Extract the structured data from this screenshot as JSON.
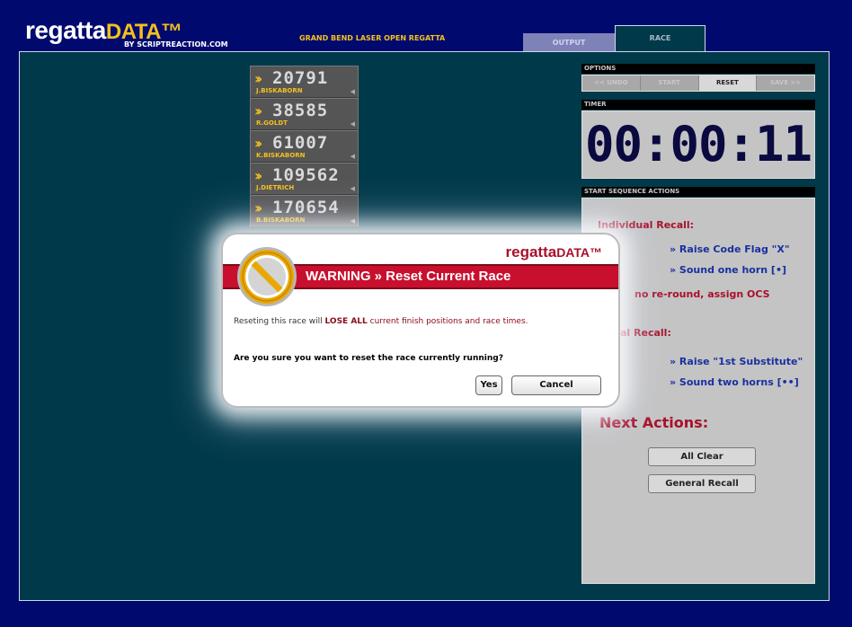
{
  "header": {
    "logo_main": "regatta",
    "logo_accent": "DATA™",
    "logo_sub": "BY SCRIPTREACTION.COM",
    "event_title": "GRAND BEND LASER OPEN REGATTA"
  },
  "tabs": [
    {
      "label": "OUTPUT",
      "active": false
    },
    {
      "label": "RACE",
      "active": true
    }
  ],
  "finishers": [
    {
      "sail": "20791",
      "name": "J.BISKABORN"
    },
    {
      "sail": "38585",
      "name": "R.GOLDT"
    },
    {
      "sail": "61007",
      "name": "K.BISKABORN"
    },
    {
      "sail": "109562",
      "name": "J.DIETRICH"
    },
    {
      "sail": "170654",
      "name": "B.BISKABORN"
    }
  ],
  "options": {
    "title": "OPTIONS",
    "buttons": [
      "<< UNDO",
      "START",
      "RESET",
      "SAVE >>"
    ],
    "active": "RESET"
  },
  "timer": {
    "title": "TIMER",
    "value": "00:00:11"
  },
  "sequence": {
    "title": "START SEQUENCE ACTIONS",
    "individual_recall": "Individual Recall:",
    "raise_x": "» Raise Code Flag \"X\"",
    "sound_one": "» Sound one horn [•]",
    "no_reround": "no re-round, assign OCS",
    "general_recall_partial": "al Recall:",
    "raise_sub": "» Raise \"1st Substitute\"",
    "sound_two": "» Sound two horns [••]",
    "next_actions": "Next Actions:",
    "all_clear": "All Clear",
    "general_recall": "General Recall"
  },
  "dialog": {
    "logo_main": "regatta",
    "logo_accent": "DATA™",
    "title": "WARNING » Reset Current Race",
    "msg_pre": "Reseting this race will ",
    "msg_highlight": "LOSE ALL",
    "msg_post": " current finish positions and race times.",
    "question": "Are you sure you want to reset the race currently running?",
    "yes": "Yes",
    "cancel": "Cancel"
  },
  "colors": {
    "background": "#000a6e",
    "panel": "#003a4a",
    "accent_yellow": "#f4c01e",
    "warning_red": "#c8102e"
  }
}
